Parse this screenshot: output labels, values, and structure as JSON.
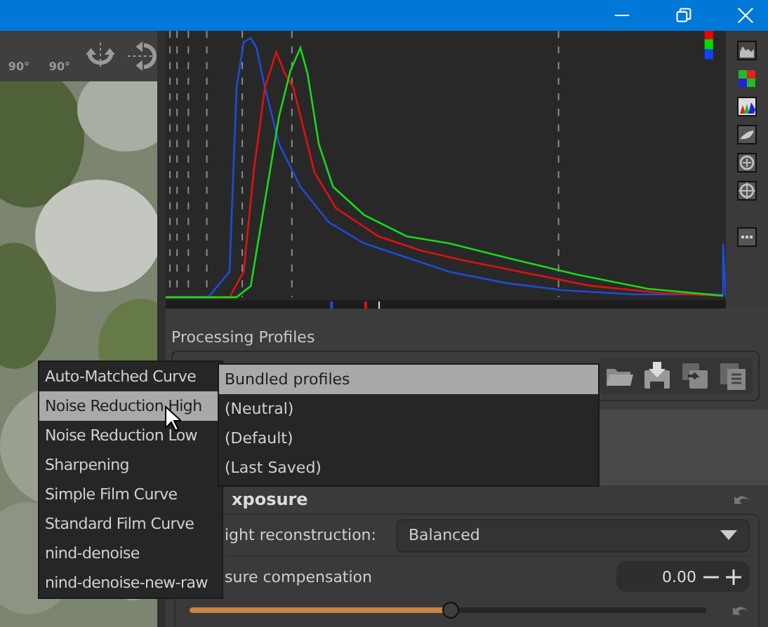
{
  "toolbar": {
    "rotate_labels": [
      "90°",
      "90°"
    ]
  },
  "processing_profiles": {
    "title": "Processing Profiles"
  },
  "profile_menu": {
    "items": [
      {
        "label": "Bundled profiles",
        "selected": true
      },
      {
        "label": "(Neutral)",
        "selected": false
      },
      {
        "label": "(Default)",
        "selected": false
      },
      {
        "label": "(Last Saved)",
        "selected": false
      }
    ]
  },
  "bundled_submenu": {
    "items": [
      {
        "label": "Auto-Matched Curve",
        "selected": false
      },
      {
        "label": "Noise Reduction High",
        "selected": true
      },
      {
        "label": "Noise Reduction Low",
        "selected": false
      },
      {
        "label": "Sharpening",
        "selected": false
      },
      {
        "label": "Simple Film Curve",
        "selected": false
      },
      {
        "label": "Standard Film Curve",
        "selected": false
      },
      {
        "label": "nind-denoise",
        "selected": false
      },
      {
        "label": "nind-denoise-new-raw",
        "selected": false
      }
    ]
  },
  "exposure": {
    "title": "xposure",
    "highlight_reconstruction": {
      "label": "ight reconstruction:",
      "value": "Balanced"
    },
    "compensation": {
      "label": "sure compensation",
      "value": "0.00",
      "level": 0.505
    }
  }
}
